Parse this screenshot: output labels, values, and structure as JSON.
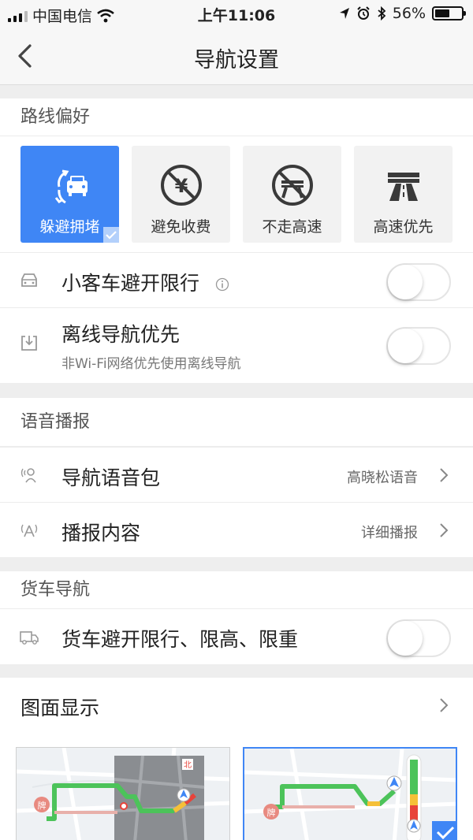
{
  "status": {
    "carrier": "中国电信",
    "time": "上午11:06",
    "battery": "56%",
    "battery_level": 0.56
  },
  "nav": {
    "title": "导航设置"
  },
  "route": {
    "header": "路线偏好",
    "cards": [
      {
        "label": "躲避拥堵",
        "icon": "avoid-congestion-icon",
        "selected": true
      },
      {
        "label": "避免收费",
        "icon": "no-toll-icon",
        "selected": false
      },
      {
        "label": "不走高速",
        "icon": "no-highway-icon",
        "selected": false
      },
      {
        "label": "高速优先",
        "icon": "highway-icon",
        "selected": false
      }
    ],
    "car_restriction": {
      "title": "小客车避开限行",
      "on": false
    },
    "offline": {
      "title": "离线导航优先",
      "subtitle": "非Wi-Fi网络优先使用离线导航",
      "on": false
    }
  },
  "voice": {
    "header": "语音播报",
    "pack": {
      "title": "导航语音包",
      "value": "高晓松语音"
    },
    "content": {
      "title": "播报内容",
      "value": "详细播报"
    }
  },
  "truck": {
    "header": "货车导航",
    "restriction": {
      "title": "货车避开限行、限高、限重",
      "on": false
    }
  },
  "map_display": {
    "title": "图面显示"
  },
  "map_preview": {
    "north_label": "北",
    "poi_label": "牌"
  },
  "colors": {
    "accent": "#3f86f5",
    "route_green": "#4cc35a",
    "traffic_red": "#e8433a",
    "traffic_yellow": "#f5c038"
  }
}
